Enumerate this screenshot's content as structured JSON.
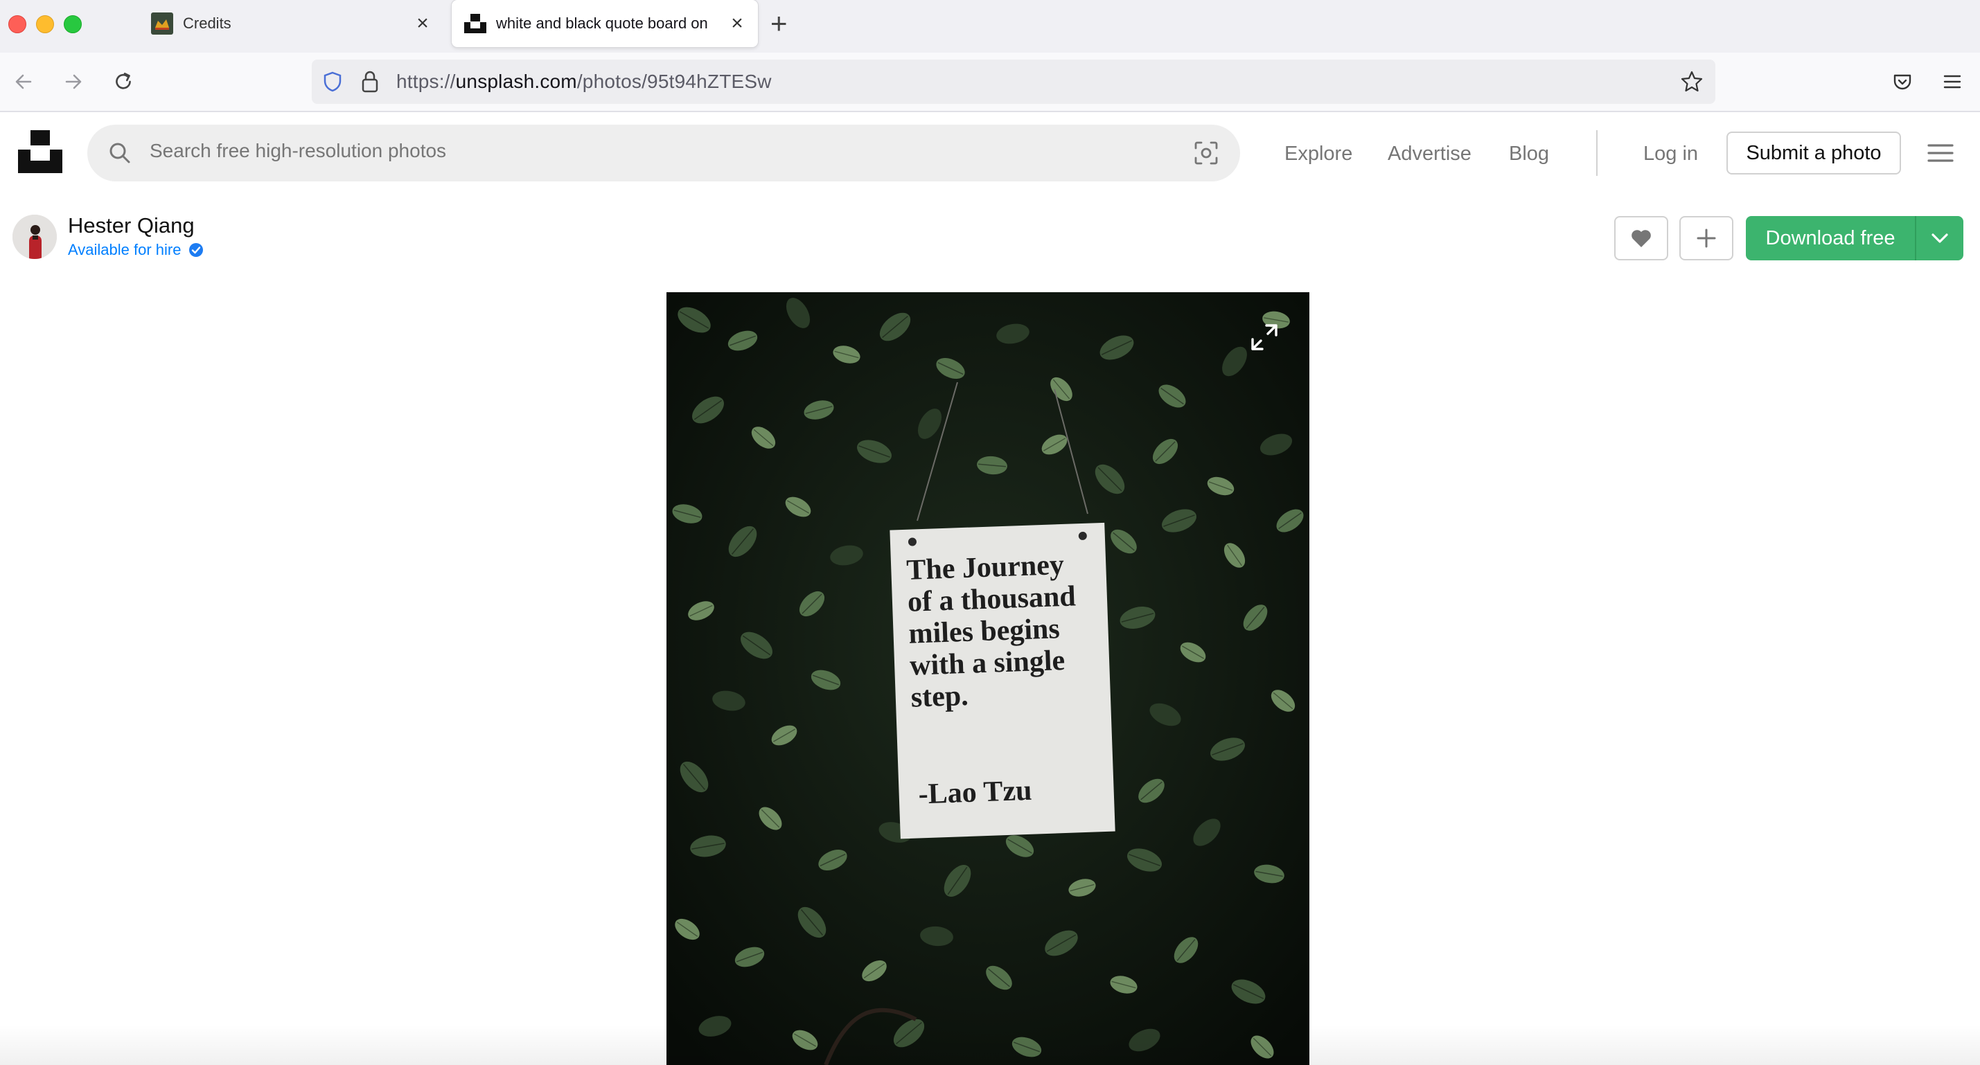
{
  "browser": {
    "tabs": [
      {
        "title": "Credits",
        "active": false
      },
      {
        "title": "white and black quote board on",
        "active": true
      }
    ],
    "url": {
      "scheme": "https://",
      "host": "unsplash.com",
      "path": "/photos/95t94hZTESw"
    }
  },
  "header": {
    "search_placeholder": "Search free high-resolution photos",
    "nav": {
      "explore": "Explore",
      "advertise": "Advertise",
      "blog": "Blog"
    },
    "login": "Log in",
    "submit": "Submit a photo"
  },
  "photo_header": {
    "author_name": "Hester Qiang",
    "hire_label": "Available for hire",
    "download_label": "Download free"
  },
  "photo": {
    "sign_lines": [
      "The Journey",
      "of a thousand",
      "miles begins",
      "with a single",
      "step."
    ],
    "sign_attribution": "-Lao Tzu"
  },
  "colors": {
    "accent_green": "#3cb46e",
    "link_blue": "#007fff"
  }
}
